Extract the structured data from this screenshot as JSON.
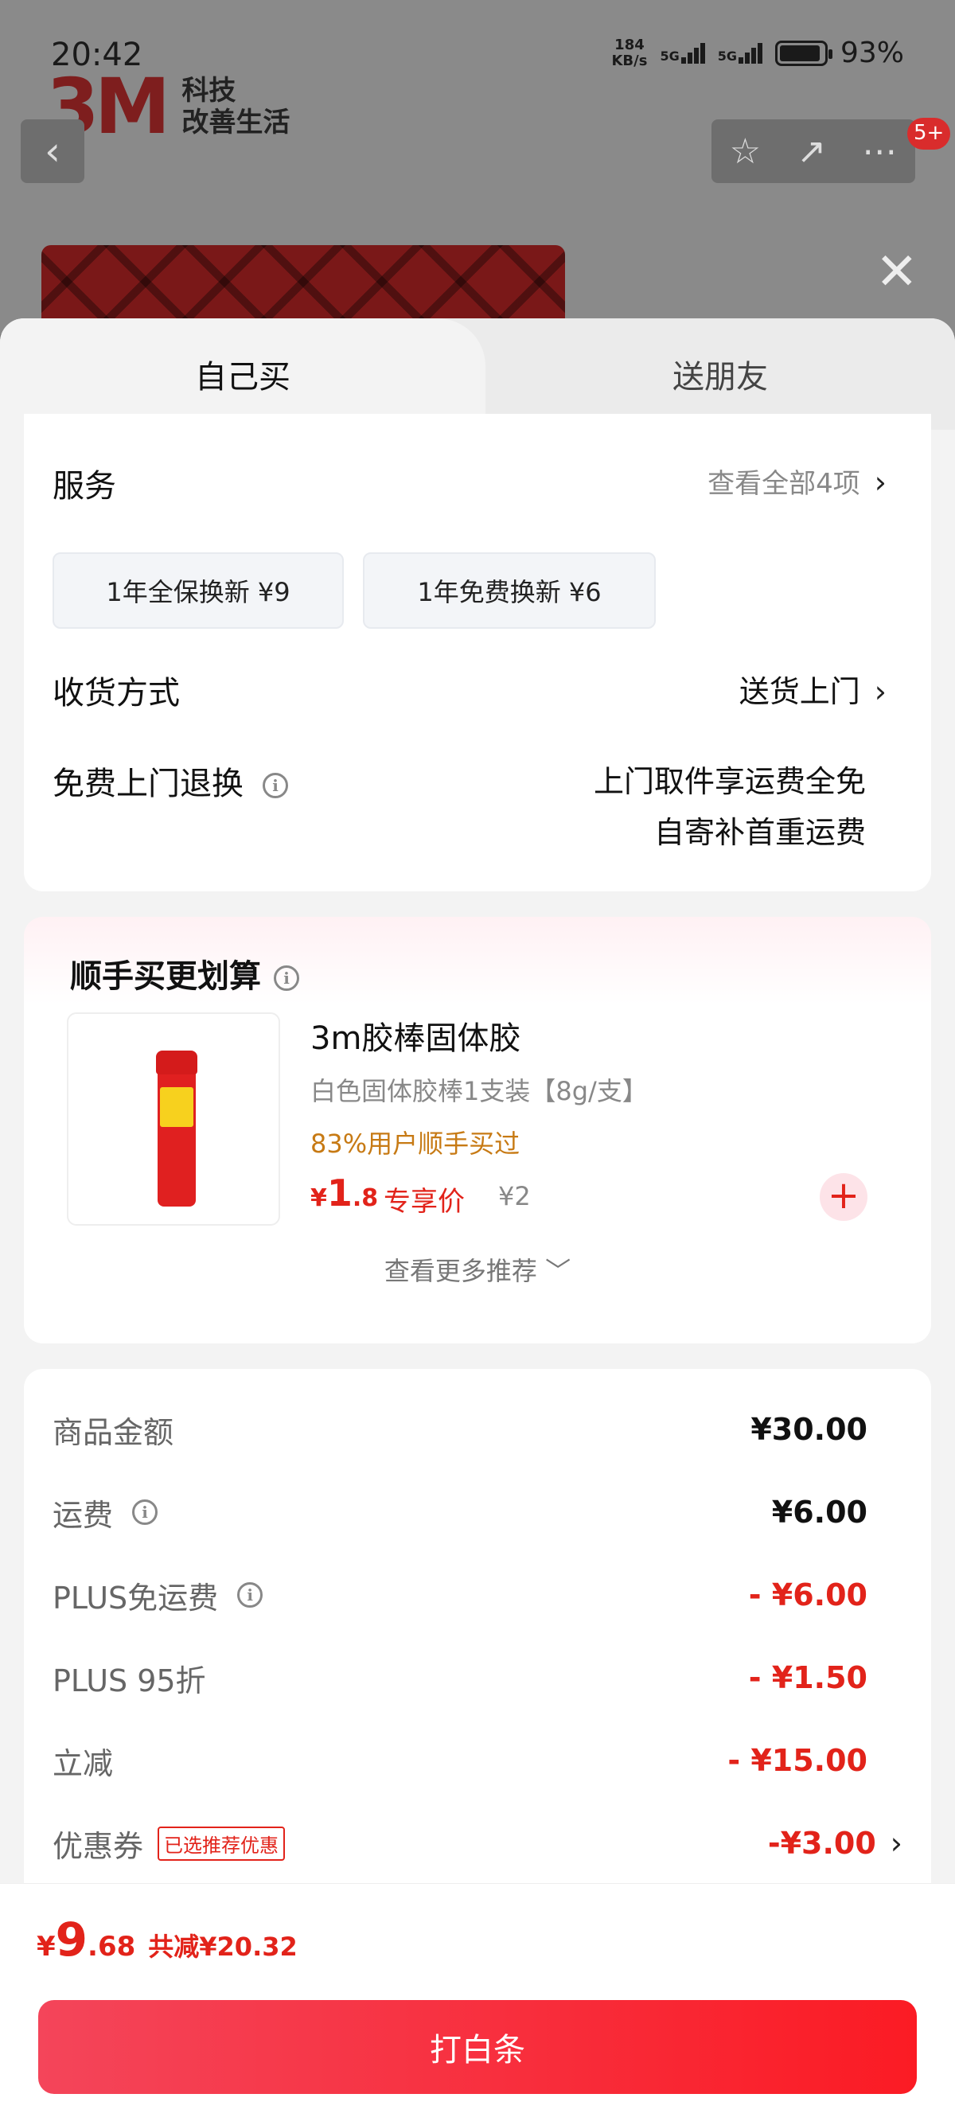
{
  "status_bar": {
    "time": "20:42",
    "net_speed_top": "184",
    "net_speed_bottom": "KB/s",
    "sig1": "5G",
    "sig2": "5G",
    "battery": "93%"
  },
  "brand": {
    "logo": "3M",
    "slogan_line1": "科技",
    "slogan_line2": "改善生活"
  },
  "header": {
    "back_icon": "‹",
    "badge": "5+"
  },
  "tabs": {
    "self": "自己买",
    "friend": "送朋友"
  },
  "service": {
    "title": "服务",
    "view_all": "查看全部4项",
    "chips": [
      "1年全保换新  ¥9",
      "1年免费换新  ¥6"
    ]
  },
  "delivery": {
    "title": "收货方式",
    "value": "送货上门"
  },
  "free_return": {
    "title": "免费上门退换",
    "line1": "上门取件享运费全免",
    "line2": "自寄补首重运费"
  },
  "addon": {
    "title": "顺手买更划算",
    "product": {
      "name": "3m胶棒固体胶",
      "spec": "白色固体胶棒1支装【8g/支】",
      "bought": "83%用户顺手买过",
      "price_cur": "¥",
      "price_int": "1",
      "price_dec": ".8",
      "tag": "专享价",
      "original": "¥2"
    },
    "more": "查看更多推荐 ﹀"
  },
  "fees": {
    "goods_label": "商品金额",
    "goods": "¥30.00",
    "shipping_label": "运费",
    "shipping": "¥6.00",
    "plus_free_label": "PLUS免运费",
    "plus_free": "- ¥6.00",
    "plus_discount_label": "PLUS 95折",
    "plus_discount": "- ¥1.50",
    "instant_label": "立减",
    "instant": "- ¥15.00",
    "coupon_label": "优惠券",
    "coupon_tag": "已选推荐优惠",
    "coupon": "-¥3.00"
  },
  "footer": {
    "cur": "¥",
    "int": "9",
    "dec": ".68",
    "saved": "共减¥20.32",
    "pay": "打白条"
  },
  "colors": {
    "accent": "#e2231a",
    "pay_gradient_start": "#f4455a",
    "pay_gradient_end": "#fb1b24"
  }
}
